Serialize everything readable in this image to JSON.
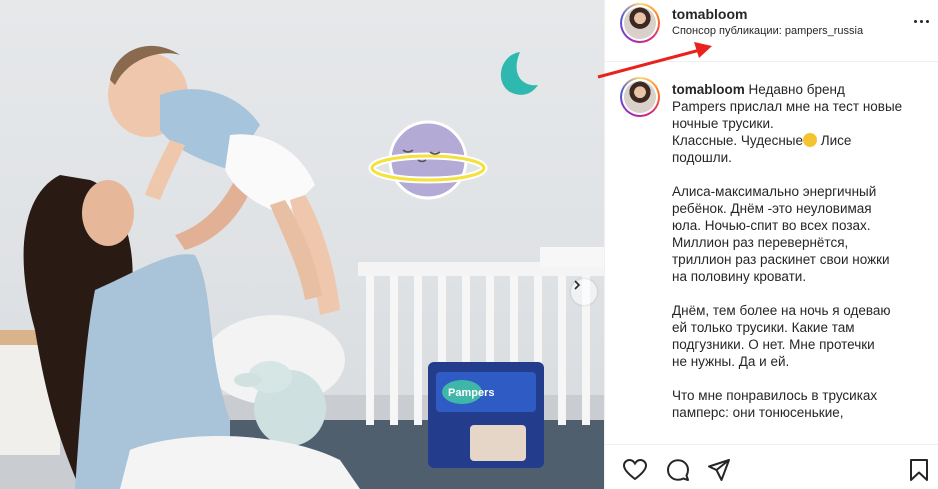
{
  "post": {
    "username": "tomabloom",
    "sponsor_line": "Спонсор публикации: pampers_russia",
    "more_label": "•••",
    "photo_alt": "tomabloom photo"
  },
  "caption": {
    "username": "tomabloom",
    "lines": [
      [
        "Недавно бренд",
        "Pampers прислал мне на тест новые",
        "ночные трусики.",
        "Классные. Чудесные",
        "подошли."
      ],
      [
        "Алиса-максимально энергичный",
        "ребёнок. Днём -это неуловимая",
        "юла. Ночью-спит во всех позах.",
        "Миллион раз перевернётся,",
        "триллион раз раскинет свои ножки",
        "на половину кровати."
      ],
      [
        "Днём, тем более на ночь я одеваю",
        "ей только трусики. Какие там",
        "подгузники. О нет. Мне протечки",
        "не нужны. Да и ей."
      ],
      [
        "Что мне понравилось в трусиках",
        "памперс: они тонюсенькие,"
      ]
    ],
    "emoji_after": " Лисе"
  },
  "pack_brand": "Pampers",
  "icons": {
    "like": "heart-icon",
    "comment": "comment-bubble-icon",
    "share": "paper-plane-icon",
    "save": "bookmark-icon",
    "next": "chevron-right-icon",
    "annotation": "red-arrow-annotation"
  },
  "colors": {
    "accent_annotation": "#e8231f",
    "text": "#262626",
    "border": "#efefef",
    "moon": "#2fb8b0",
    "planet": "#b3aad6",
    "ring": "#f4e13a"
  }
}
